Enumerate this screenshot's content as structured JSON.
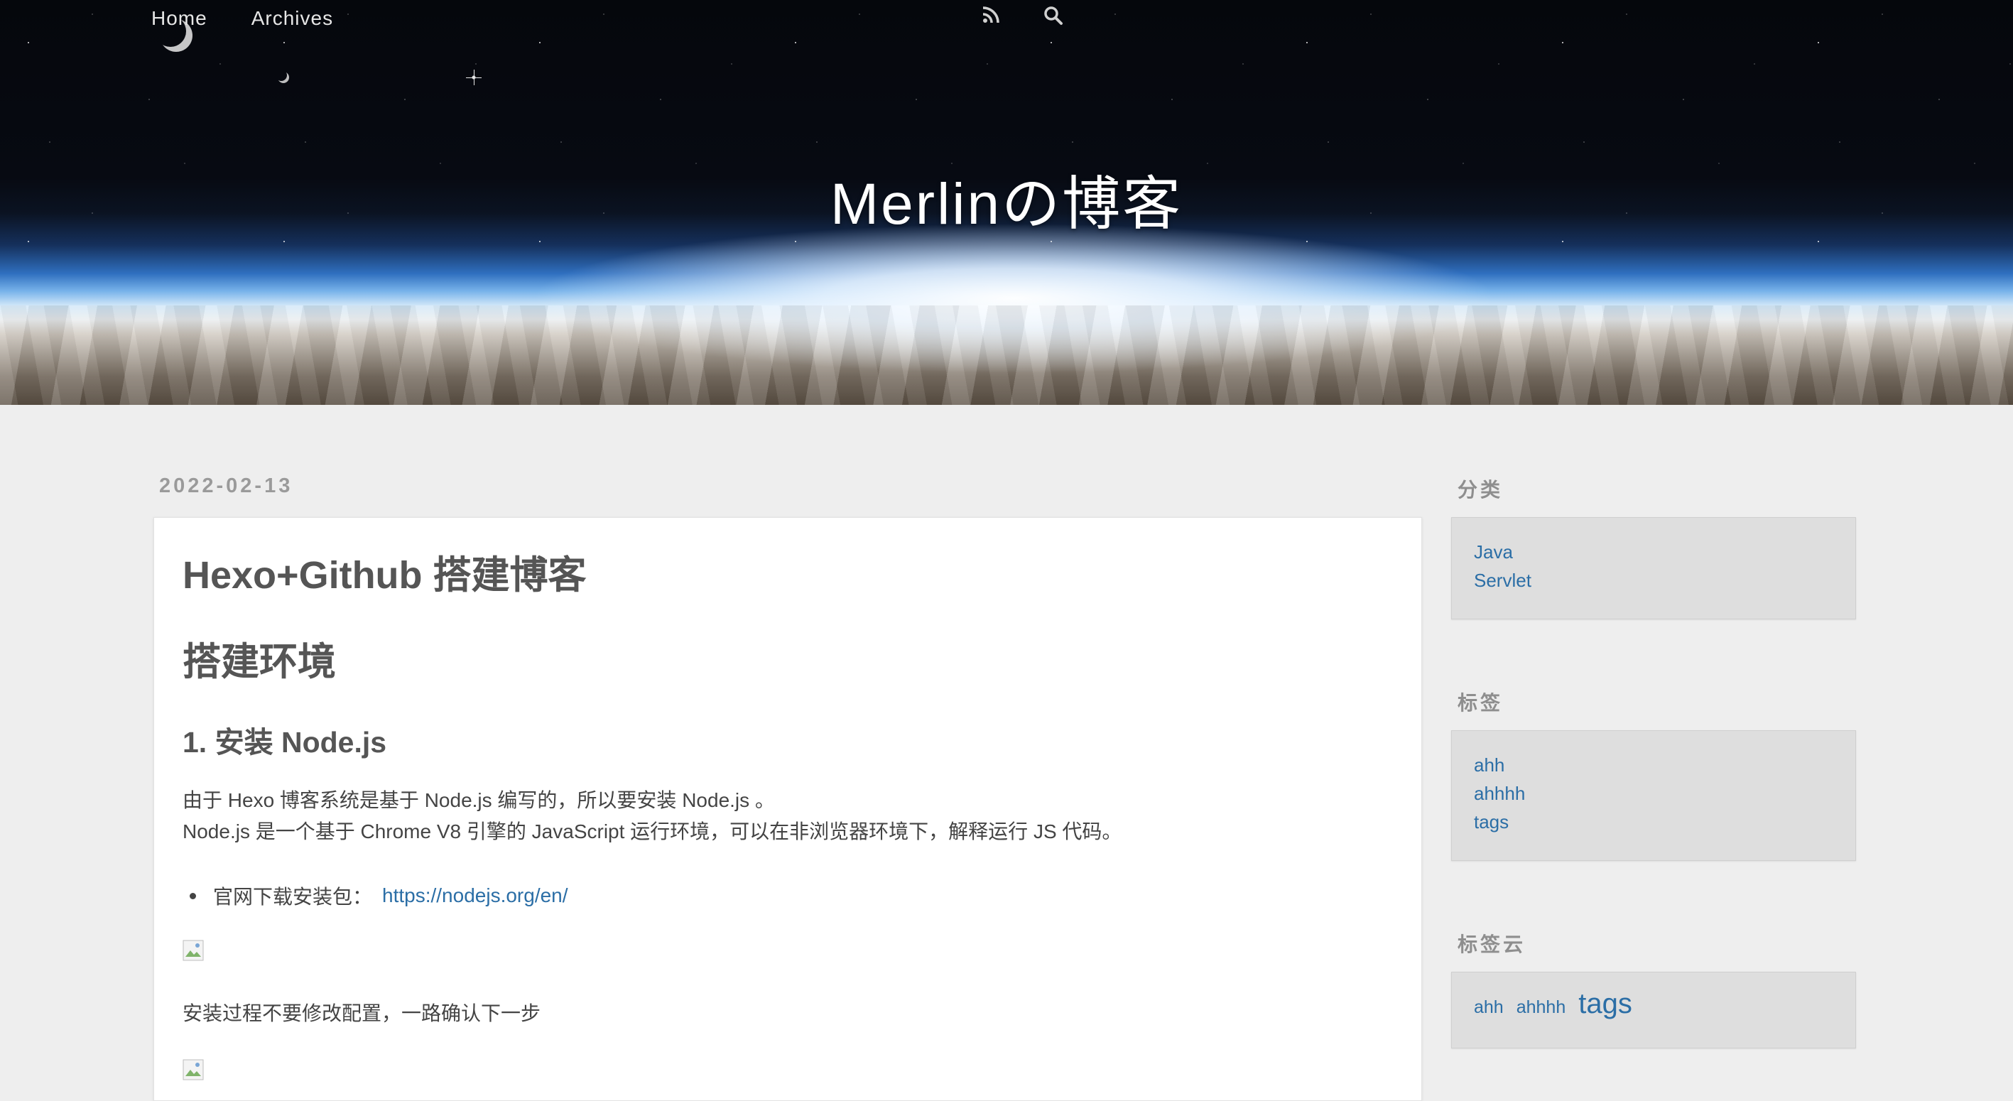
{
  "nav": {
    "home": "Home",
    "archives": "Archives",
    "rss_icon": "rss-icon",
    "search_icon": "search-icon"
  },
  "site": {
    "title": "Merlinの博客"
  },
  "post": {
    "date": "2022-02-13",
    "title": "Hexo+Github 搭建博客",
    "h2": "搭建环境",
    "h3": "1. 安装 Node.js",
    "para1": "由于 Hexo 博客系统是基于 Node.js 编写的，所以要安装 Node.js 。",
    "para2": "Node.js 是一个基于 Chrome V8 引擎的 JavaScript 运行环境，可以在非浏览器环境下，解释运行 JS 代码。",
    "bullet_text": "官网下载安装包：",
    "bullet_link": "https://nodejs.org/en/",
    "note": "安装过程不要修改配置，一路确认下一步"
  },
  "sidebar": {
    "categories_heading": "分类",
    "categories": [
      "Java",
      "Servlet"
    ],
    "tags_heading": "标签",
    "tags": [
      "ahh",
      "ahhhh",
      "tags"
    ],
    "tagcloud_heading": "标签云",
    "tagcloud": [
      "ahh",
      "ahhhh",
      "tags"
    ]
  },
  "colors": {
    "link": "#2b6ea6",
    "page_bg": "#eeeeee",
    "text": "#555555"
  }
}
